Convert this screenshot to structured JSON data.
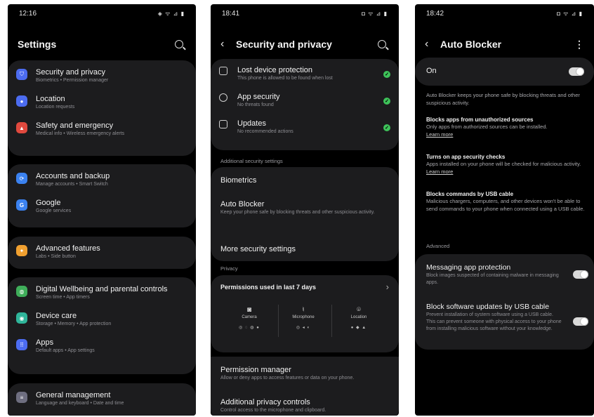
{
  "settings": {
    "status_time": "12:16",
    "status_icons": "◈ ᯤ ⊿ ▮",
    "title": "Settings",
    "groups": [
      [
        {
          "title": "Security and privacy",
          "subtitle": "Biometrics • Permission manager",
          "color": "#4c6cf0"
        },
        {
          "title": "Location",
          "subtitle": "Location requests",
          "color": "#4c6cf0"
        },
        {
          "title": "Safety and emergency",
          "subtitle": "Medical info • Wireless emergency alerts",
          "color": "#e0493e"
        }
      ],
      [
        {
          "title": "Accounts and backup",
          "subtitle": "Manage accounts • Smart Switch",
          "color": "#3b82f0"
        },
        {
          "title": "Google",
          "subtitle": "Google services",
          "color": "#3b82f0"
        }
      ],
      [
        {
          "title": "Advanced features",
          "subtitle": "Labs • Side button",
          "color": "#f0a030"
        }
      ],
      [
        {
          "title": "Digital Wellbeing and parental controls",
          "subtitle": "Screen time • App timers",
          "color": "#3fae5a"
        },
        {
          "title": "Device care",
          "subtitle": "Storage • Memory • App protection",
          "color": "#2fb59a"
        },
        {
          "title": "Apps",
          "subtitle": "Default apps • App settings",
          "color": "#4c6cf0"
        }
      ],
      [
        {
          "title": "General management",
          "subtitle": "Language and keyboard • Date and time",
          "color": "#6e6e80"
        }
      ]
    ]
  },
  "security": {
    "status_time": "18:41",
    "status_icons": "◘ ᯤ ⊿ ▮",
    "title": "Security and privacy",
    "checks": [
      {
        "title": "Lost device protection",
        "subtitle": "This phone is allowed to be found when lost"
      },
      {
        "title": "App security",
        "subtitle": "No threats found"
      },
      {
        "title": "Updates",
        "subtitle": "No recommended actions"
      }
    ],
    "additional_label": "Additional security settings",
    "biometrics": "Biometrics",
    "auto_blocker_title": "Auto Blocker",
    "auto_blocker_sub": "Keep your phone safe by blocking threats and other suspicious activity.",
    "more_security": "More security settings",
    "privacy_label": "Privacy",
    "permissions_title": "Permissions used in last 7 days",
    "perm_cols": [
      {
        "label": "Camera",
        "apps": "◎ ◌ ◍ ●"
      },
      {
        "label": "Microphone",
        "apps": "◎ ◂ ◐"
      },
      {
        "label": "Location",
        "apps": "● ◆ ▲"
      }
    ],
    "permission_manager": "Permission manager",
    "permission_manager_sub": "Allow or deny apps to access features or data on your phone.",
    "additional_privacy": "Additional privacy controls",
    "additional_privacy_sub": "Control access to the microphone and clipboard."
  },
  "autoblocker": {
    "status_time": "18:42",
    "status_icons": "◘ ᯤ ⊿ ▮",
    "title": "Auto Blocker",
    "on_label": "On",
    "intro": "Auto Blocker keeps your phone safe by blocking threats and other suspicious activity.",
    "features": [
      {
        "title": "Blocks apps from unauthorized sources",
        "body": "Only apps from authorized sources can be installed.",
        "link": "Learn more"
      },
      {
        "title": "Turns on app security checks",
        "body": "Apps installed on your phone will be checked for malicious activity.",
        "link": "Learn more"
      },
      {
        "title": "Blocks commands by USB cable",
        "body": "Malicious chargers, computers, and other devices won't be able to send commands to your phone when connected using a USB cable.",
        "link": ""
      }
    ],
    "advanced_label": "Advanced",
    "advanced": [
      {
        "title": "Messaging app protection",
        "subtitle": "Block images suspected of containing malware in messaging apps."
      },
      {
        "title": "Block software updates by USB cable",
        "subtitle": "Prevent installation of system software using a USB cable. This can prevent someone with physical access to your phone from installing malicious software without your knowledge."
      }
    ]
  }
}
